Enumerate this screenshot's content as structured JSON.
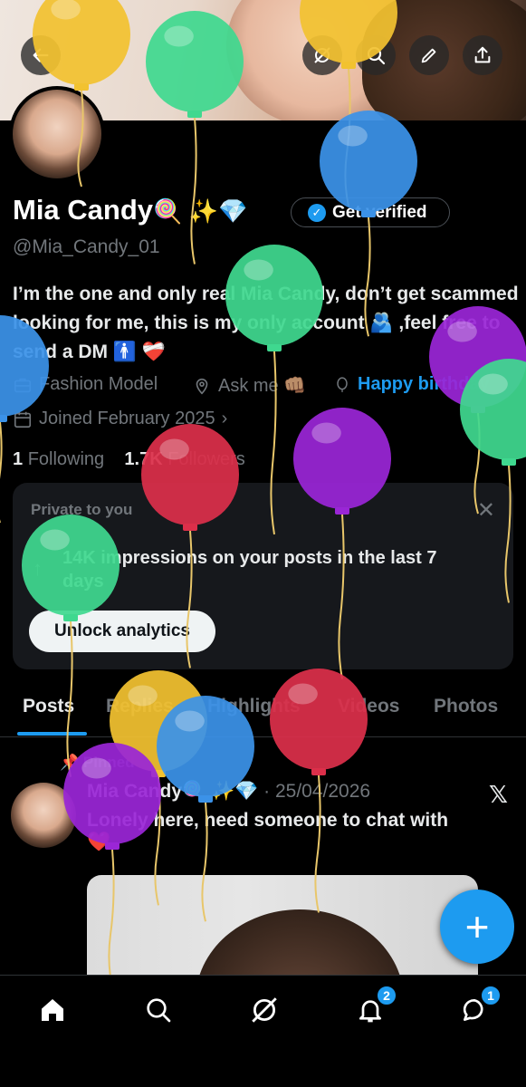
{
  "profile": {
    "name": "Mia Candy",
    "name_emoji": "🍭 ✨💎",
    "verify_label": "Get verified",
    "handle": "@Mia_Candy_01",
    "bio": "I’m the one and only real Mia Candy, don’t get scammed looking for me, this is my only account 🫂 ,feel free to send a DM 🚹 ❤️‍🩹",
    "category": "Fashion Model",
    "location": "Ask me 👊🏽",
    "birthday": "Happy birthday",
    "joined": "Joined February 2025",
    "following_count": "1",
    "following_label": "Following",
    "followers_count": "1.7K",
    "followers_label": "Followers"
  },
  "private_card": {
    "title": "Private to you",
    "text": "14K impressions on your posts in the last 7 days",
    "button": "Unlock analytics"
  },
  "tabs": [
    "Posts",
    "Replies",
    "Highlights",
    "Videos",
    "Photos"
  ],
  "post": {
    "pinned_label": "Pinned",
    "author": "Mia Candy",
    "author_emoji": "🍭 ✨💎",
    "date": "· 25/04/2026",
    "text": "Lonely here, need someone to chat with",
    "text_emoji": "❤️"
  },
  "nav": {
    "notifications_badge": "2",
    "messages_badge": "1"
  },
  "colors": {
    "accent": "#1d9bf0",
    "balloon_yellow": "#f2c230",
    "balloon_green": "#3fd88f",
    "balloon_blue": "#3b92e8",
    "balloon_purple": "#9a26d6",
    "balloon_red": "#dc2f4a"
  },
  "icons": [
    "back-arrow-icon",
    "grok-icon",
    "search-icon",
    "edit-pencil-icon",
    "share-icon",
    "verified-badge-icon",
    "briefcase-icon",
    "location-pin-icon",
    "balloon-icon",
    "calendar-icon",
    "close-icon",
    "arrow-up-icon",
    "pin-icon",
    "x-logo-icon",
    "plus-icon",
    "home-icon",
    "grok-nav-icon",
    "bell-icon",
    "chat-icon"
  ]
}
